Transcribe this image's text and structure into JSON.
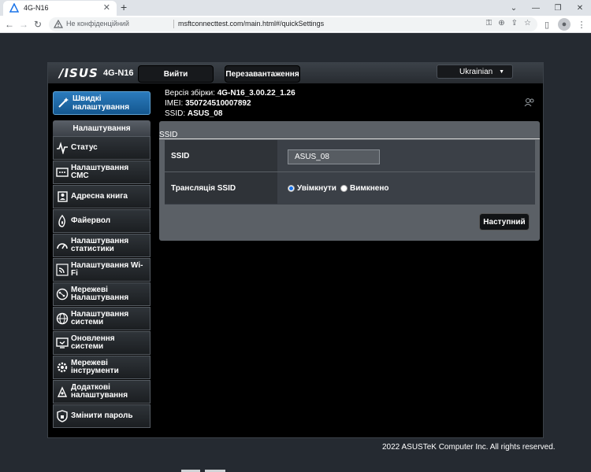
{
  "browser": {
    "tab_title": "4G-N16",
    "not_secure_label": "Не конфіденційний",
    "url": "msftconnecttest.com/main.html#/quickSettings"
  },
  "header": {
    "logo": "/ISUS",
    "model": "4G-N16",
    "logout_label": "Вийти",
    "reboot_label": "Перезавантаження",
    "language": "Ukrainian"
  },
  "info": {
    "build_label": "Версія збірки:",
    "build_value": "4G-N16_3.00.22_1.26",
    "imei_label": "IMEI:",
    "imei_value": "350724510007892",
    "ssid_label": "SSID:",
    "ssid_value": "ASUS_08"
  },
  "sidebar": {
    "quick_settings": "Швидкі налаштування",
    "menu_title": "Налаштування",
    "items": [
      {
        "label": "Статус",
        "icon": "pulse-icon"
      },
      {
        "label": "Налаштування СМС",
        "icon": "sms-icon"
      },
      {
        "label": "Адресна книга",
        "icon": "address-book-icon"
      },
      {
        "label": "Файервол",
        "icon": "firewall-icon"
      },
      {
        "label": "Налаштування статистики",
        "icon": "statistics-icon"
      },
      {
        "label": "Налаштування Wi-Fi",
        "icon": "wifi-icon"
      },
      {
        "label": "Мережеві Налаштування",
        "icon": "network-icon"
      },
      {
        "label": "Налаштування системи",
        "icon": "globe-icon"
      },
      {
        "label": "Оновлення системи",
        "icon": "update-icon"
      },
      {
        "label": "Мережеві інструменти",
        "icon": "gear-icon"
      },
      {
        "label": "Додаткові налаштування",
        "icon": "advanced-icon"
      },
      {
        "label": "Змінити пароль",
        "icon": "lock-icon"
      }
    ]
  },
  "content": {
    "section_title": "SSID",
    "ssid_field_label": "SSID",
    "ssid_value": "ASUS_08",
    "broadcast_label": "Трансляція SSID",
    "option_on": "Увімкнути",
    "option_off": "Вимкнено",
    "broadcast_selected": "Увімкнути",
    "next_label": "Наступний"
  },
  "footer": {
    "copyright": "2022 ASUSTeK Computer Inc. All rights reserved."
  }
}
